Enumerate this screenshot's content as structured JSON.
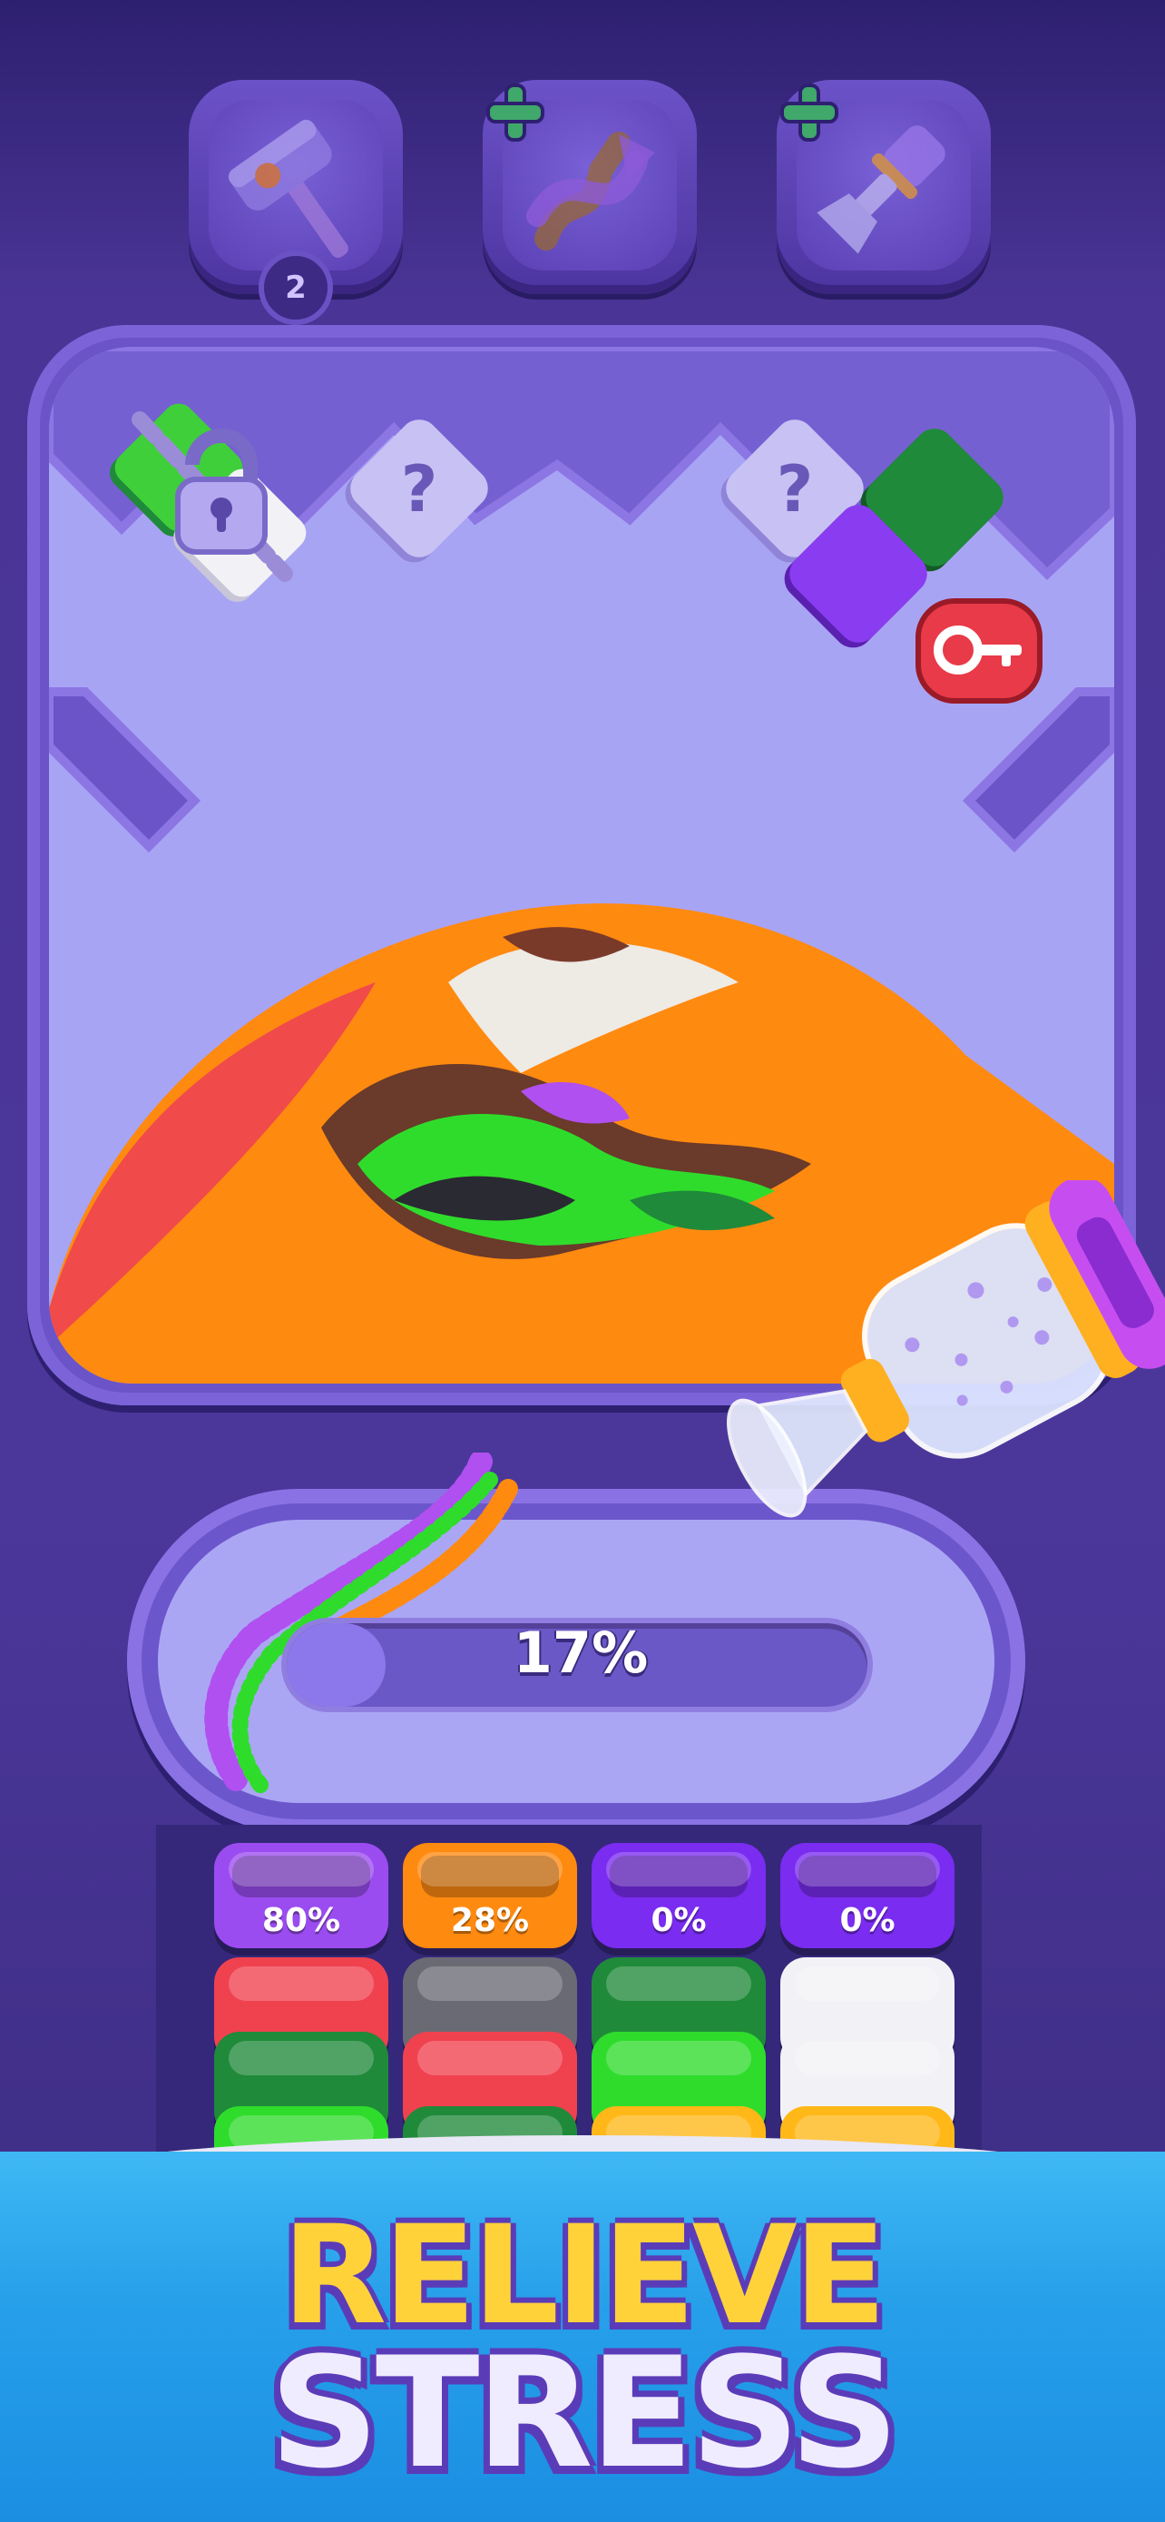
{
  "boosters": [
    {
      "name": "hammer",
      "icon": "hammer-icon",
      "count": "2"
    },
    {
      "name": "shuffle",
      "icon": "shuffle-arrows-icon",
      "badge": "plus-icon"
    },
    {
      "name": "spray",
      "icon": "spray-bottle-icon",
      "badge": "plus-icon"
    }
  ],
  "board": {
    "locked_block": {
      "icon": "padlock-chain-icon"
    },
    "key_block": {
      "icon": "key-icon"
    },
    "mystery_blocks": [
      "?",
      "?"
    ]
  },
  "progress": {
    "label": "17%",
    "value": 0.17
  },
  "cups": [
    {
      "top": {
        "color": "#9b4cf0",
        "label": "80%"
      },
      "stack": [
        "#f0414f",
        "#1f8a3a",
        "#2fdc2c"
      ]
    },
    {
      "top": {
        "color": "#ff8a10",
        "label": "28%"
      },
      "stack": [
        "#6a6a74",
        "#f0414f",
        "#1f8a3a"
      ]
    },
    {
      "top": {
        "color": "#7a2cf0",
        "label": "0%"
      },
      "stack": [
        "#1f8a3a",
        "#2fdc2c",
        "#ffb818"
      ]
    },
    {
      "top": {
        "color": "#7a2cf0",
        "label": "0%"
      },
      "stack": [
        "#f2f2f6",
        "#f2f2f6",
        "#ffb818"
      ]
    }
  ],
  "banner": {
    "line1": "RELIEVE",
    "line2": "STRESS"
  },
  "colors": {
    "background": "#4b379a",
    "board": "#a8a4f4",
    "accent_yellow": "#ffd23a",
    "banner_blue": "#27a0ea"
  }
}
